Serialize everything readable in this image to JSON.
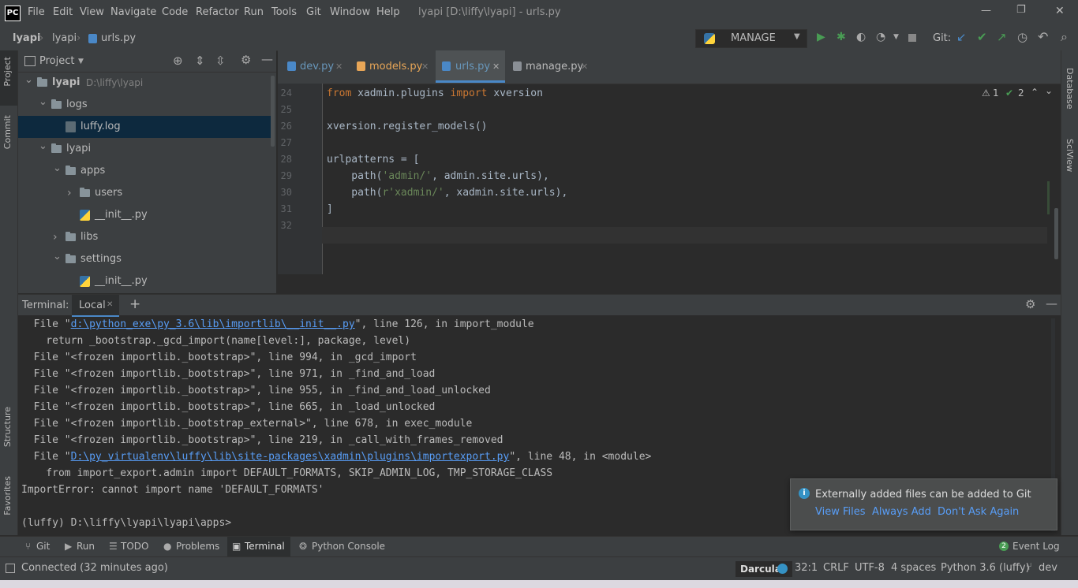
{
  "titlebar": {
    "logo": "PC",
    "menu": [
      "File",
      "Edit",
      "View",
      "Navigate",
      "Code",
      "Refactor",
      "Run",
      "Tools",
      "Git",
      "Window",
      "Help"
    ],
    "title": "lyapi [D:\\liffy\\lyapi] - urls.py",
    "minimize": "—",
    "maximize": "❐",
    "close": "✕"
  },
  "navbar": {
    "breadcrumb": [
      "lyapi",
      "lyapi",
      "urls.py"
    ],
    "run_config": "MANAGE",
    "git_label": "Git:"
  },
  "left_strip": {
    "tabs": [
      "Project",
      "Commit",
      "Structure",
      "Favorites"
    ]
  },
  "right_strip": {
    "tabs": [
      "Database",
      "SciView"
    ]
  },
  "project": {
    "header": "Project",
    "tree": [
      {
        "label": "lyapi",
        "path": "D:\\liffy\\lyapi",
        "level": 0,
        "kind": "folder",
        "expanded": true
      },
      {
        "label": "logs",
        "level": 1,
        "kind": "folder",
        "expanded": true
      },
      {
        "label": "luffy.log",
        "level": 2,
        "kind": "log",
        "selected": true
      },
      {
        "label": "lyapi",
        "level": 1,
        "kind": "folder",
        "expanded": true
      },
      {
        "label": "apps",
        "level": 2,
        "kind": "folder",
        "expanded": true
      },
      {
        "label": "users",
        "level": 3,
        "kind": "folder",
        "expanded": false
      },
      {
        "label": "__init__.py",
        "level": 3,
        "kind": "py"
      },
      {
        "label": "libs",
        "level": 2,
        "kind": "folder",
        "expanded": false
      },
      {
        "label": "settings",
        "level": 2,
        "kind": "folder",
        "expanded": true
      },
      {
        "label": "__init__.py",
        "level": 3,
        "kind": "py"
      }
    ]
  },
  "editor": {
    "tabs": [
      {
        "label": "dev.py",
        "color": "#6897bb",
        "active": false
      },
      {
        "label": "models.py",
        "color": "#e8a657",
        "active": false
      },
      {
        "label": "urls.py",
        "color": "#6897bb",
        "active": true
      },
      {
        "label": "manage.py",
        "color": "#bbbbbb",
        "active": false
      }
    ],
    "warnings": "1",
    "checks": "2",
    "lines": [
      {
        "num": "24",
        "tokens": [
          {
            "t": "from",
            "c": "kw"
          },
          {
            "t": " xadmin.plugins ",
            "c": "fn"
          },
          {
            "t": "import",
            "c": "kw"
          },
          {
            "t": " xversion",
            "c": "fn"
          }
        ]
      },
      {
        "num": "25",
        "tokens": []
      },
      {
        "num": "26",
        "tokens": [
          {
            "t": "xversion.register_models()",
            "c": "fn"
          }
        ]
      },
      {
        "num": "27",
        "tokens": []
      },
      {
        "num": "28",
        "tokens": [
          {
            "t": "urlpatterns = [",
            "c": "fn"
          }
        ]
      },
      {
        "num": "29",
        "tokens": [
          {
            "t": "    path(",
            "c": "fn"
          },
          {
            "t": "'admin/'",
            "c": "str"
          },
          {
            "t": ", admin.site.urls),",
            "c": "fn"
          }
        ]
      },
      {
        "num": "30",
        "tokens": [
          {
            "t": "    path(",
            "c": "fn"
          },
          {
            "t": "r'xadmin/'",
            "c": "str"
          },
          {
            "t": ", xadmin.site.urls),",
            "c": "fn"
          }
        ]
      },
      {
        "num": "31",
        "tokens": [
          {
            "t": "]",
            "c": "fn"
          }
        ]
      },
      {
        "num": "32",
        "tokens": []
      }
    ]
  },
  "terminal": {
    "label": "Terminal:",
    "tab": "Local",
    "add": "+",
    "lines": [
      {
        "pre": "  File \"",
        "link": "d:\\python_exe\\py_3.6\\lib\\importlib\\__init__.py",
        "post": "\", line 126, in import_module"
      },
      {
        "pre": "    return _bootstrap._gcd_import(name[level:], package, level)",
        "link": "",
        "post": ""
      },
      {
        "pre": "  File \"<frozen importlib._bootstrap>\", line 994, in _gcd_import",
        "link": "",
        "post": ""
      },
      {
        "pre": "  File \"<frozen importlib._bootstrap>\", line 971, in _find_and_load",
        "link": "",
        "post": ""
      },
      {
        "pre": "  File \"<frozen importlib._bootstrap>\", line 955, in _find_and_load_unlocked",
        "link": "",
        "post": ""
      },
      {
        "pre": "  File \"<frozen importlib._bootstrap>\", line 665, in _load_unlocked",
        "link": "",
        "post": ""
      },
      {
        "pre": "  File \"<frozen importlib._bootstrap_external>\", line 678, in exec_module",
        "link": "",
        "post": ""
      },
      {
        "pre": "  File \"<frozen importlib._bootstrap>\", line 219, in _call_with_frames_removed",
        "link": "",
        "post": ""
      },
      {
        "pre": "  File \"",
        "link": "D:\\py_virtualenv\\luffy\\lib\\site-packages\\xadmin\\plugins\\importexport.py",
        "post": "\", line 48, in <module>"
      },
      {
        "pre": "    from import_export.admin import DEFAULT_FORMATS, SKIP_ADMIN_LOG, TMP_STORAGE_CLASS",
        "link": "",
        "post": ""
      },
      {
        "pre": "ImportError: cannot import name 'DEFAULT_FORMATS'",
        "link": "",
        "post": ""
      },
      {
        "pre": "",
        "link": "",
        "post": ""
      },
      {
        "pre": "(luffy) D:\\liffy\\lyapi\\lyapi\\apps>",
        "link": "",
        "post": ""
      }
    ]
  },
  "notification": {
    "message": "Externally added files can be added to Git",
    "actions": [
      "View Files",
      "Always Add",
      "Don't Ask Again"
    ]
  },
  "toolwindows": {
    "items": [
      "Git",
      "Run",
      "TODO",
      "Problems",
      "Terminal",
      "Python Console"
    ],
    "event_log": "Event Log",
    "event_count": "2"
  },
  "status": {
    "connected": "Connected (32 minutes ago)",
    "theme": "Darcula",
    "position": "32:1",
    "line_sep": "CRLF",
    "encoding": "UTF-8",
    "indent": "4 spaces",
    "interpreter": "Python 3.6 (luffy)",
    "branch": "dev"
  }
}
